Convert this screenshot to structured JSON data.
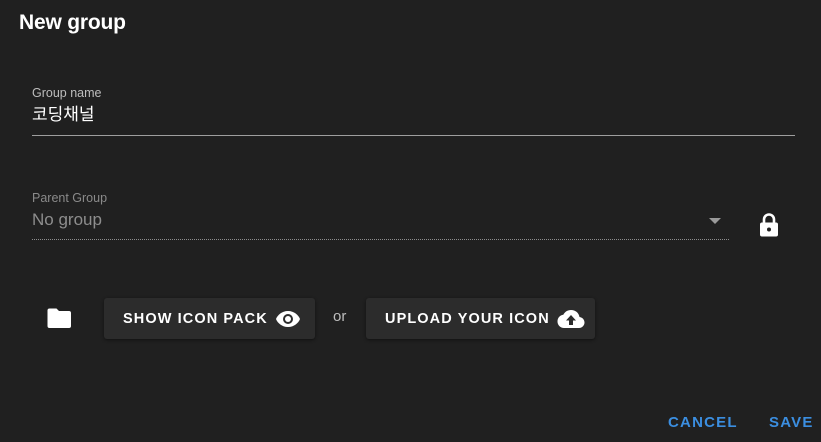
{
  "dialog": {
    "title": "New group"
  },
  "group_name": {
    "label": "Group name",
    "value": "코딩채널"
  },
  "parent_group": {
    "label": "Parent Group",
    "value": "No group",
    "locked": true
  },
  "icon_section": {
    "folder_icon": "folder-icon",
    "show_icon_pack_label": "SHOW ICON PACK",
    "show_icon_pack_icon": "eye-icon",
    "or_text": "or",
    "upload_icon_label": "UPLOAD YOUR ICON",
    "upload_icon_icon": "cloud-upload-icon"
  },
  "actions": {
    "cancel_label": "CANCEL",
    "save_label": "SAVE"
  },
  "colors": {
    "background": "#202020",
    "accent": "#3b8ee0",
    "button_bg": "#2c2c2c"
  }
}
